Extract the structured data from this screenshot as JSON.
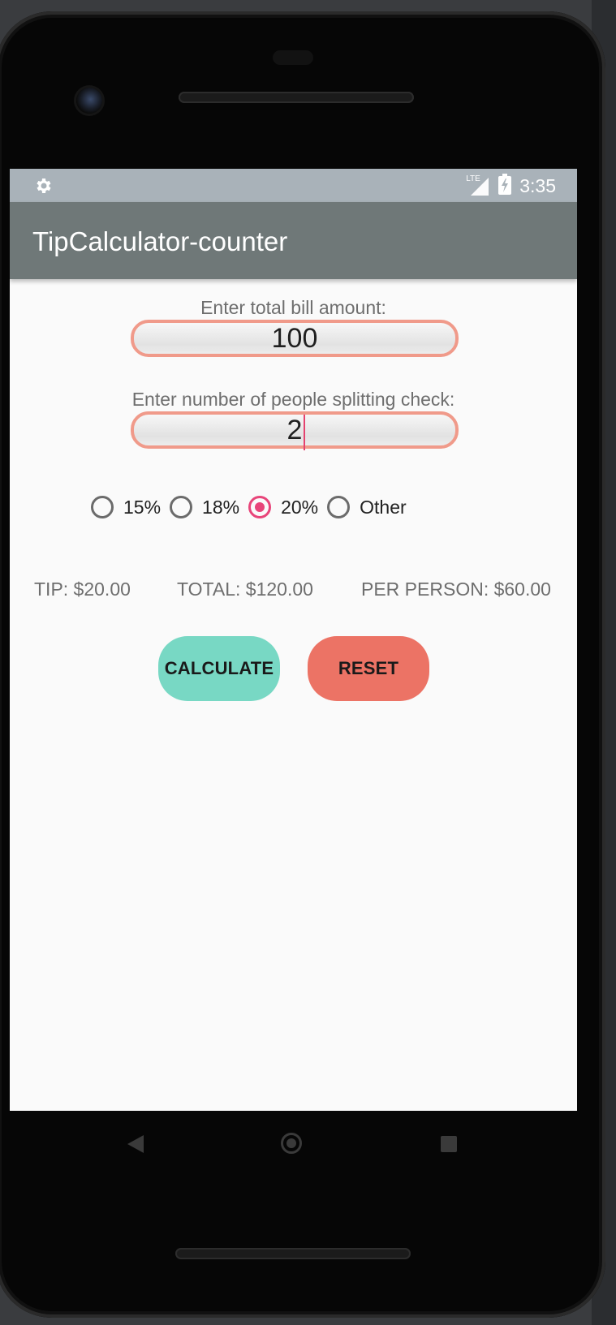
{
  "status_bar": {
    "time": "3:35",
    "network": "LTE",
    "icons": [
      "settings-gear-icon",
      "lte-signal-icon",
      "battery-charging-icon"
    ]
  },
  "app_bar": {
    "title": "TipCalculator-counter"
  },
  "bill": {
    "label": "Enter total bill amount:",
    "value": "100"
  },
  "people": {
    "label": "Enter number of people splitting check:",
    "value": "2"
  },
  "tip_options": [
    {
      "label": "15%",
      "checked": false
    },
    {
      "label": "18%",
      "checked": false
    },
    {
      "label": "20%",
      "checked": true
    },
    {
      "label": "Other",
      "checked": false
    }
  ],
  "results": {
    "tip": "TIP: $20.00",
    "total": "TOTAL: $120.00",
    "per_person": "PER PERSON: $60.00"
  },
  "buttons": {
    "calculate": "CALCULATE",
    "reset": "RESET"
  },
  "colors": {
    "accent": "#e8457a",
    "app_bar": "#6f7878",
    "status_bar": "#a9b2b9",
    "field_border": "#f09a8a",
    "calculate_button": "#78d8c4",
    "reset_button": "#ec7365"
  },
  "nav_bar": {
    "icons": [
      "back-icon",
      "home-icon",
      "recents-icon"
    ]
  }
}
